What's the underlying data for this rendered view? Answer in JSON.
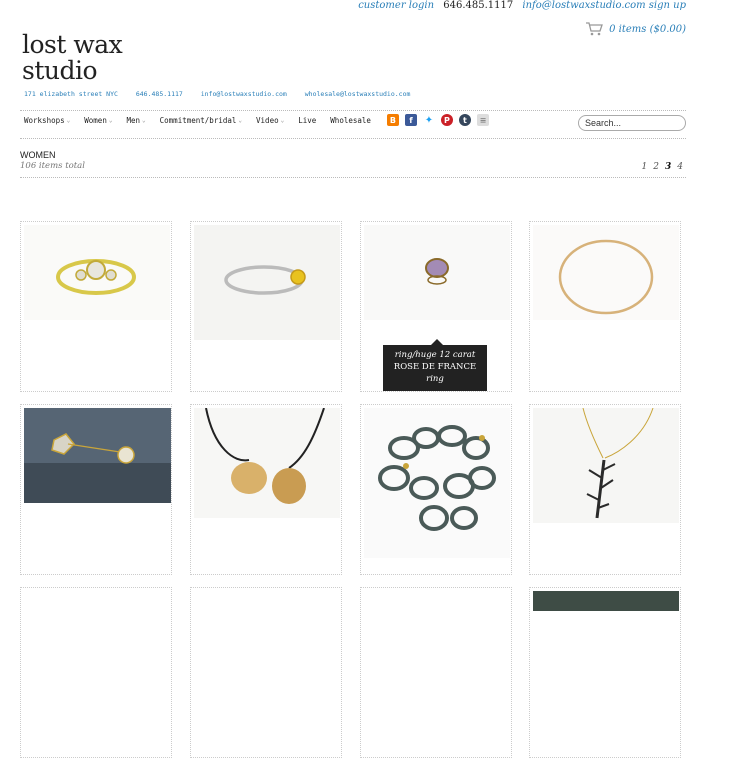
{
  "header": {
    "customer_login": "customer login",
    "phone": "646.485.1117",
    "email_signup": "info@lostwaxstudio.com sign up",
    "cart": "0 items ($0.00)"
  },
  "logo": {
    "line1": "lost wax",
    "line2": "studio"
  },
  "address_bar": {
    "address": "171 elizabeth street NYC",
    "phone": "646.485.1117",
    "info_email": "info@lostwaxstudio.com",
    "wholesale_email": "wholesale@lostwaxstudio.com"
  },
  "nav": {
    "items": [
      {
        "label": "Workshops",
        "has_menu": true
      },
      {
        "label": "Women",
        "has_menu": true
      },
      {
        "label": "Men",
        "has_menu": true
      },
      {
        "label": "Commitment/bridal",
        "has_menu": true
      },
      {
        "label": "Video",
        "has_menu": true
      },
      {
        "label": "Live",
        "has_menu": false
      },
      {
        "label": "Wholesale",
        "has_menu": false
      }
    ],
    "social_icons": [
      "blogger-icon",
      "facebook-icon",
      "twitter-icon",
      "pinterest-icon",
      "tumblr-icon",
      "rss-feed-icon"
    ],
    "search_placeholder": "Search..."
  },
  "category": {
    "title": "WOMEN",
    "count": "106 items total"
  },
  "pagination": {
    "pages": [
      "1",
      "2",
      "3",
      "4"
    ],
    "current": "3"
  },
  "tooltip": {
    "line1": "ring/huge 12 carat",
    "line2": "ROSE DE FRANCE",
    "line3": "ring"
  },
  "products": [
    "diamond-three-stone-ring-image",
    "yellow-stone-silver-ring-image",
    "rose-de-france-ring-image",
    "gold-bangle-image",
    "rough-diamond-pearl-studs-image",
    "gold-cone-pendant-cord-image",
    "oxidized-chain-necklace-image",
    "branch-pendant-necklace-image"
  ],
  "colors": {
    "link": "#2a7fb8",
    "tooltip_bg": "#222222"
  }
}
